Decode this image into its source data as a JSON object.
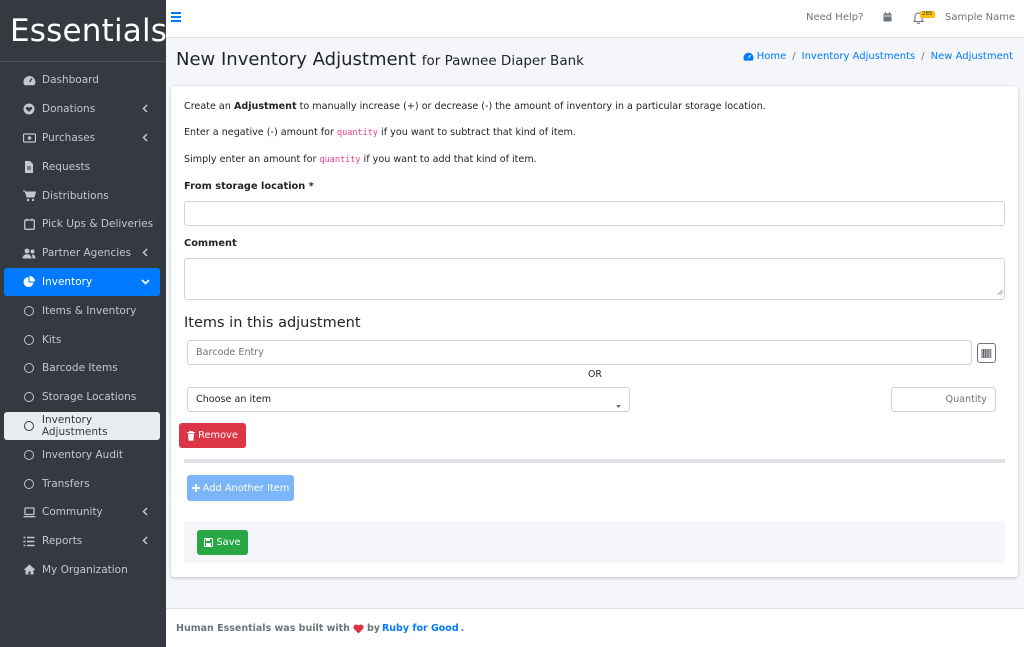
{
  "brand": "Essentials",
  "sidebar": {
    "items": [
      {
        "label": "Dashboard",
        "icon": "tachometer-icon"
      },
      {
        "label": "Donations",
        "icon": "heart-icon"
      },
      {
        "label": "Purchases",
        "icon": "money-icon"
      },
      {
        "label": "Requests",
        "icon": "file-icon"
      },
      {
        "label": "Distributions",
        "icon": "cart-icon"
      },
      {
        "label": "Pick Ups & Deliveries",
        "icon": "calendar-icon"
      },
      {
        "label": "Partner Agencies",
        "icon": "users-icon"
      },
      {
        "label": "Inventory",
        "icon": "pie-chart-icon"
      },
      {
        "label": "Items & Inventory",
        "icon": "circle-icon"
      },
      {
        "label": "Kits",
        "icon": "circle-icon"
      },
      {
        "label": "Barcode Items",
        "icon": "circle-icon"
      },
      {
        "label": "Storage Locations",
        "icon": "circle-icon"
      },
      {
        "label": "Inventory Adjustments",
        "icon": "circle-icon"
      },
      {
        "label": "Inventory Audit",
        "icon": "circle-icon"
      },
      {
        "label": "Transfers",
        "icon": "circle-icon"
      },
      {
        "label": "Community",
        "icon": "laptop-icon"
      },
      {
        "label": "Reports",
        "icon": "list-icon"
      },
      {
        "label": "My Organization",
        "icon": "home-icon"
      }
    ]
  },
  "topbar": {
    "help": "Need Help?",
    "badge": "285",
    "user": "Sample Name"
  },
  "header": {
    "title": "New Inventory Adjustment",
    "subtitle": "for Pawnee Diaper Bank"
  },
  "breadcrumb": {
    "home": "Home",
    "section": "Inventory Adjustments",
    "current": "New Adjustment",
    "sep": "/"
  },
  "intro": {
    "l1_a": "Create an ",
    "l1_b": "Adjustment",
    "l1_c": " to manually increase (+) or decrease (-) the amount of inventory in a particular storage location.",
    "l2_a": "Enter a negative (-) amount for ",
    "l2_code": "quantity",
    "l2_c": " if you want to subtract that kind of item.",
    "l3_a": "Simply enter an amount for ",
    "l3_code": "quantity",
    "l3_c": " if you want to add that kind of item."
  },
  "form": {
    "storage_label": "From storage location *",
    "comment_label": "Comment",
    "items_heading": "Items in this adjustment",
    "barcode_placeholder": "Barcode Entry",
    "or": "OR",
    "choose_item": "Choose an item",
    "quantity_placeholder": "Quantity",
    "remove": "Remove",
    "add_item": "Add Another Item",
    "save": "Save"
  },
  "footer": {
    "pre": "Human Essentials was built with",
    "by": "by",
    "org": "Ruby for Good",
    "dot": "."
  },
  "colors": {
    "primary": "#007bff",
    "danger": "#dc3545",
    "success": "#28a745",
    "sidebar": "#343a40"
  }
}
